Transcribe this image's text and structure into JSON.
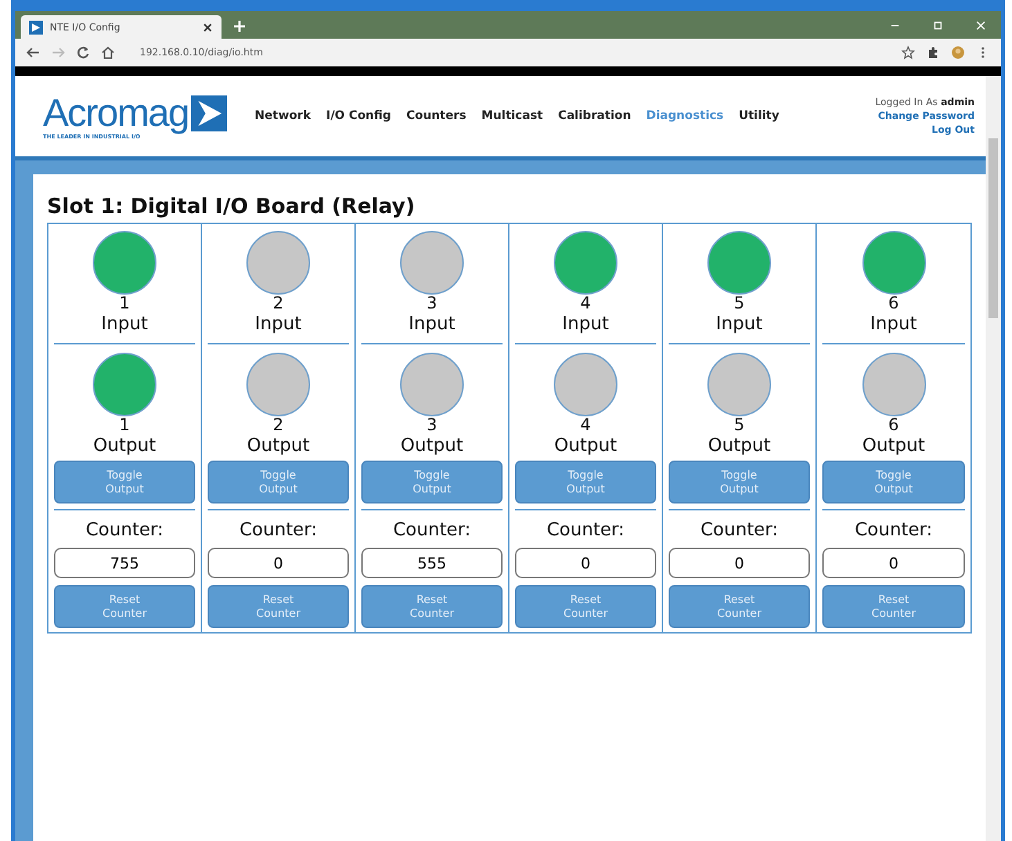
{
  "browser": {
    "tab_title": "NTE I/O Config",
    "url": "192.168.0.10/diag/io.htm"
  },
  "header": {
    "logo": "Acromag",
    "tagline": "THE LEADER IN INDUSTRIAL I/O",
    "nav": [
      {
        "label": "Network",
        "selected": false
      },
      {
        "label": "I/O Config",
        "selected": false
      },
      {
        "label": "Counters",
        "selected": false
      },
      {
        "label": "Multicast",
        "selected": false
      },
      {
        "label": "Calibration",
        "selected": false
      },
      {
        "label": "Diagnostics",
        "selected": true
      },
      {
        "label": "Utility",
        "selected": false
      }
    ],
    "logged_in_label": "Logged In As",
    "user": "admin",
    "change_password": "Change Password",
    "log_out": "Log Out"
  },
  "panel": {
    "title": "Slot 1: Digital I/O Board (Relay)",
    "channels": [
      {
        "number": "1",
        "input_label": "Input",
        "input_on": true,
        "output_number": "1",
        "output_label": "Output",
        "output_on": true,
        "toggle_button": "Toggle Output",
        "counter_label": "Counter:",
        "counter": "755",
        "reset_button": "Reset Counter"
      },
      {
        "number": "2",
        "input_label": "Input",
        "input_on": false,
        "output_number": "2",
        "output_label": "Output",
        "output_on": false,
        "toggle_button": "Toggle Output",
        "counter_label": "Counter:",
        "counter": "0",
        "reset_button": "Reset Counter"
      },
      {
        "number": "3",
        "input_label": "Input",
        "input_on": false,
        "output_number": "3",
        "output_label": "Output",
        "output_on": false,
        "toggle_button": "Toggle Output",
        "counter_label": "Counter:",
        "counter": "555",
        "reset_button": "Reset Counter"
      },
      {
        "number": "4",
        "input_label": "Input",
        "input_on": true,
        "output_number": "4",
        "output_label": "Output",
        "output_on": false,
        "toggle_button": "Toggle Output",
        "counter_label": "Counter:",
        "counter": "0",
        "reset_button": "Reset Counter"
      },
      {
        "number": "5",
        "input_label": "Input",
        "input_on": true,
        "output_number": "5",
        "output_label": "Output",
        "output_on": false,
        "toggle_button": "Toggle Output",
        "counter_label": "Counter:",
        "counter": "0",
        "reset_button": "Reset Counter"
      },
      {
        "number": "6",
        "input_label": "Input",
        "input_on": true,
        "output_number": "6",
        "output_label": "Output",
        "output_on": false,
        "toggle_button": "Toggle Output",
        "counter_label": "Counter:",
        "counter": "0",
        "reset_button": "Reset Counter"
      }
    ]
  }
}
